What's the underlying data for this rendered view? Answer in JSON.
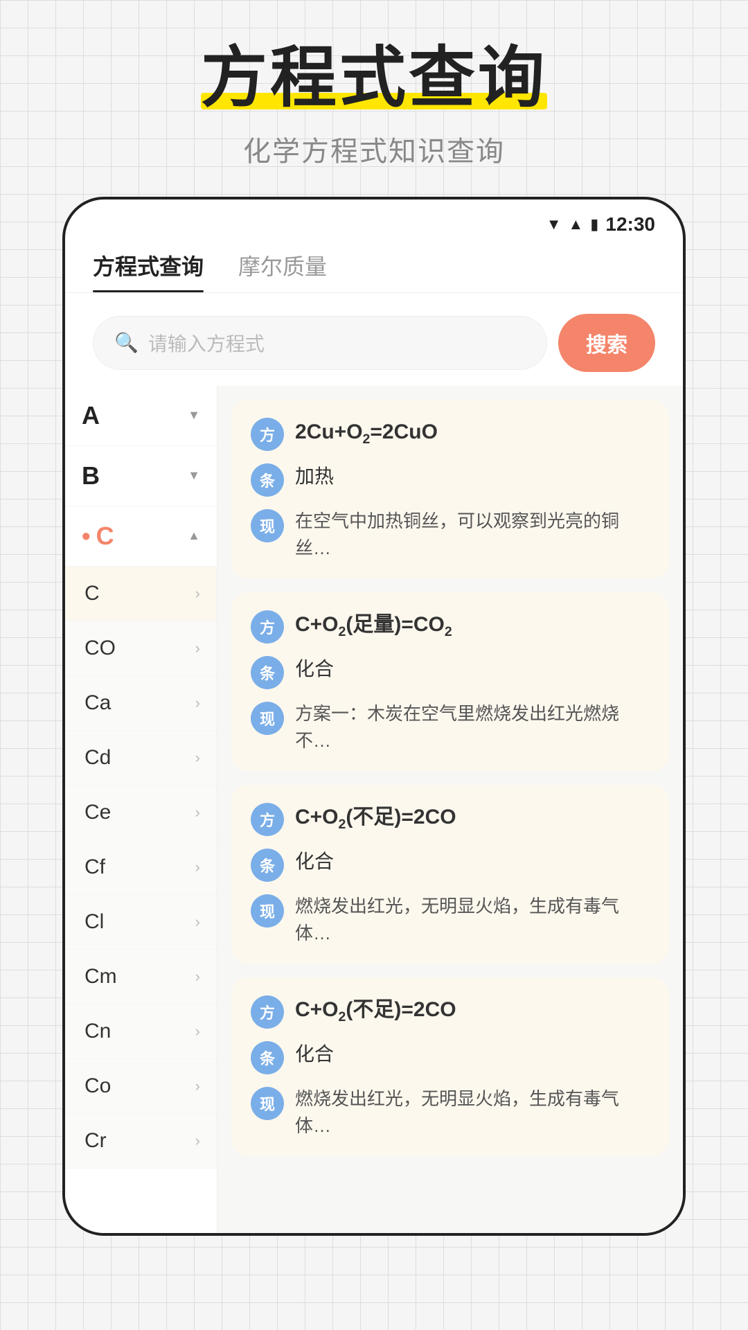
{
  "header": {
    "main_title": "方程式查询",
    "sub_title": "化学方程式知识查询",
    "highlight": true
  },
  "status_bar": {
    "time": "12:30",
    "wifi": "▼",
    "signal": "▲",
    "battery": "🔋"
  },
  "tabs": [
    {
      "id": "equation",
      "label": "方程式查询",
      "active": true
    },
    {
      "id": "molar",
      "label": "摩尔质量",
      "active": false
    }
  ],
  "search": {
    "placeholder": "请输入方程式",
    "button_label": "搜索"
  },
  "sidebar": {
    "groups": [
      {
        "letter": "A",
        "expanded": false
      },
      {
        "letter": "B",
        "expanded": false
      },
      {
        "letter": "C",
        "expanded": true,
        "active": true,
        "items": [
          {
            "label": "C",
            "selected": true
          },
          {
            "label": "CO"
          },
          {
            "label": "Ca"
          },
          {
            "label": "Cd"
          },
          {
            "label": "Ce"
          },
          {
            "label": "Cf"
          },
          {
            "label": "Cl"
          },
          {
            "label": "Cm"
          },
          {
            "label": "Cn"
          },
          {
            "label": "Co"
          },
          {
            "label": "Cr"
          }
        ]
      }
    ]
  },
  "equations": [
    {
      "id": 1,
      "formula": "2Cu+O₂=2CuO",
      "condition": "加热",
      "description": "在空气中加热铜丝，可以观察到光亮的铜丝…"
    },
    {
      "id": 2,
      "formula": "C+O₂(足量)=CO₂",
      "condition": "化合",
      "description": "方案一：木炭在空气里燃烧发出红光燃烧不…"
    },
    {
      "id": 3,
      "formula": "C+O₂(不足)=2CO",
      "condition": "化合",
      "description": "燃烧发出红光，无明显火焰，生成有毒气体…"
    },
    {
      "id": 4,
      "formula": "C+O₂(不足)=2CO",
      "condition": "化合",
      "description": "燃烧发出红光，无明显火焰，生成有毒气体…"
    }
  ],
  "badges": {
    "formula": "方",
    "condition": "条",
    "description": "现"
  }
}
